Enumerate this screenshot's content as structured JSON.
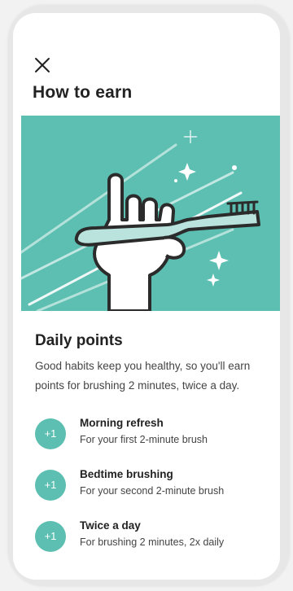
{
  "header": {
    "title": "How to earn"
  },
  "daily_points": {
    "title": "Daily points",
    "description": "Good habits keep you healthy, so you'll earn points for brushing 2 minutes, twice a day."
  },
  "items": [
    {
      "badge": "+1",
      "title": "Morning refresh",
      "subtitle": "For your first 2-minute brush"
    },
    {
      "badge": "+1",
      "title": "Bedtime brushing",
      "subtitle": "For your second 2-minute brush"
    },
    {
      "badge": "+1",
      "title": "Twice a day",
      "subtitle": "For brushing 2 minutes, 2x daily"
    }
  ],
  "icons": {
    "close": "close-icon",
    "hero": "hand-holding-toothbrush-illustration"
  },
  "colors": {
    "accent": "#5cbfb1",
    "text": "#222222",
    "muted": "#444444"
  }
}
